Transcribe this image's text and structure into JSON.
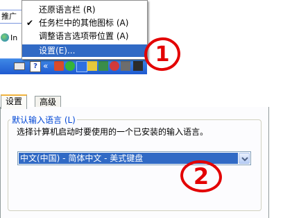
{
  "background_window": {
    "tab_fragment": "推广",
    "address_fragment": "In"
  },
  "context_menu": {
    "items": [
      {
        "label": "还原语言栏 (R)",
        "checked": false,
        "selected": false
      },
      {
        "label": "任务栏中的其他图标 (A)",
        "checked": true,
        "selected": false
      },
      {
        "label": "调整语言选项带位置 (A)",
        "checked": false,
        "selected": false
      },
      {
        "label": "设置(E)...",
        "checked": false,
        "selected": true
      }
    ],
    "check_glyph": "✔"
  },
  "taskbar": {
    "icons": [
      "keyboard-icon",
      "help-icon",
      "chevron-icon",
      "tray-icon",
      "tray-icon",
      "tray-icon",
      "tray-icon",
      "tray-icon",
      "tray-icon",
      "tray-icon",
      "tray-icon"
    ],
    "help_glyph": "?",
    "chevron_glyph": "«",
    "color": "#245edb"
  },
  "annotations": {
    "step_1": "1",
    "step_2": "2",
    "color": "#e30000"
  },
  "dialog": {
    "tabs": [
      {
        "label": "设置",
        "active": true
      },
      {
        "label": "高级",
        "active": false
      }
    ],
    "group_title": "默认输入语言 (L)",
    "group_description": "选择计算机启动时要使用的一个已安装的输入语言。",
    "input_language_select": {
      "value": "中文(中国) - 简体中文 - 美式键盘"
    }
  }
}
